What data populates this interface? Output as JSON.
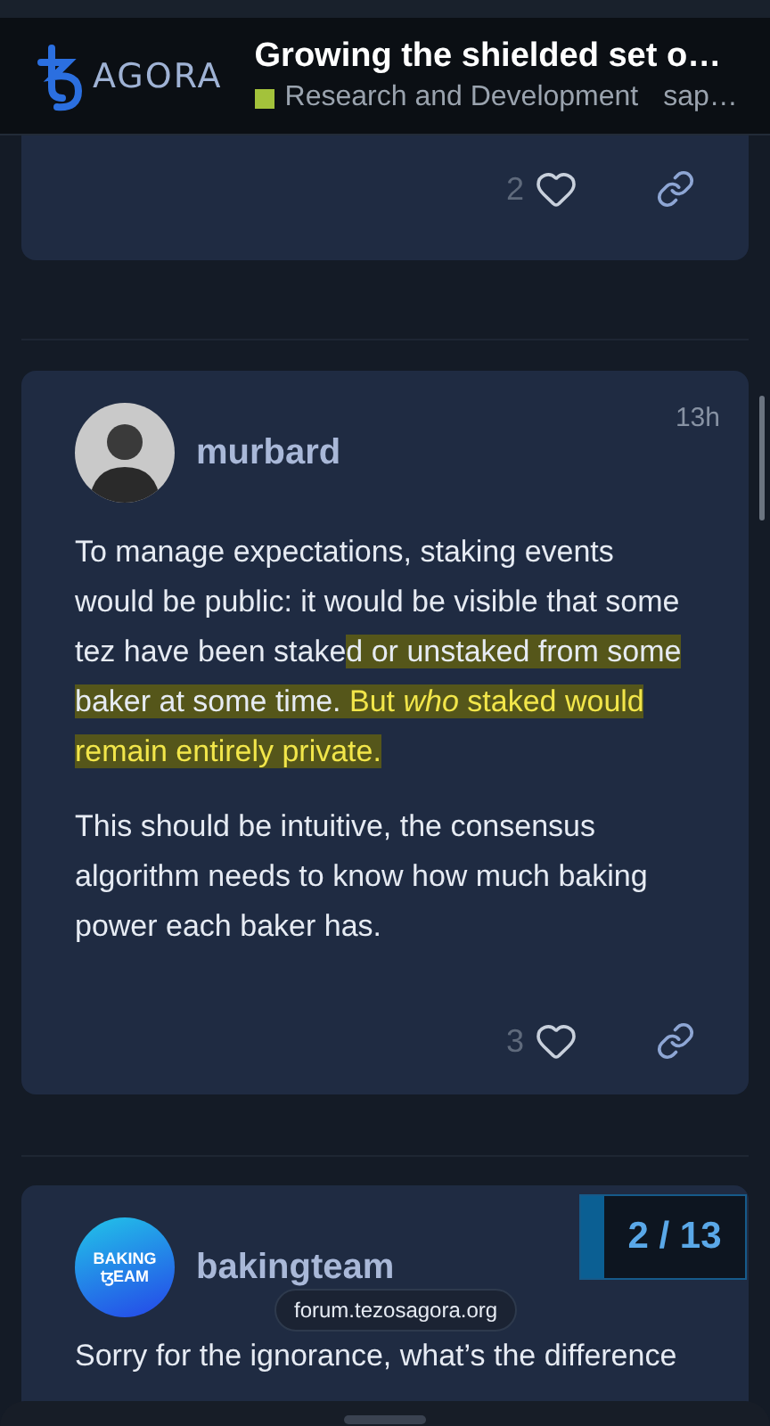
{
  "header": {
    "logo_text": "AGORA",
    "title": "Growing the shielded set o…",
    "category": {
      "name": "Research and Development",
      "color": "#a3c23b"
    },
    "tag": "sap…"
  },
  "posts": [
    {
      "kind": "tail",
      "likes": "2"
    },
    {
      "kind": "full",
      "author": "murbard",
      "avatar": {
        "kind": "person"
      },
      "time": "13h",
      "paragraphs": [
        [
          {
            "text": "To manage expectations, staking events would be public: it would be visible that some tez have been stake",
            "marked": false,
            "accent": false
          },
          {
            "text": "d or unstaked from some baker at some time.",
            "marked": true,
            "accent": false
          },
          {
            "text": " But *who* staked would remain entirely private.",
            "marked": true,
            "accent": true
          }
        ],
        [
          {
            "text": "This should be intuitive, the consensus algorithm needs to know how much baking power each baker has.",
            "marked": false,
            "accent": false
          }
        ]
      ],
      "likes": "3"
    },
    {
      "kind": "head",
      "author": "bakingteam",
      "avatar": {
        "kind": "logo",
        "lines": [
          "BAKING",
          "ꜩEAM"
        ]
      },
      "paragraphs": [
        [
          {
            "text": "Sorry for the ignorance, what’s the difference",
            "marked": false,
            "accent": false
          }
        ]
      ]
    }
  ],
  "progress": "2 / 13",
  "url_pill": "forum.tezosagora.org"
}
